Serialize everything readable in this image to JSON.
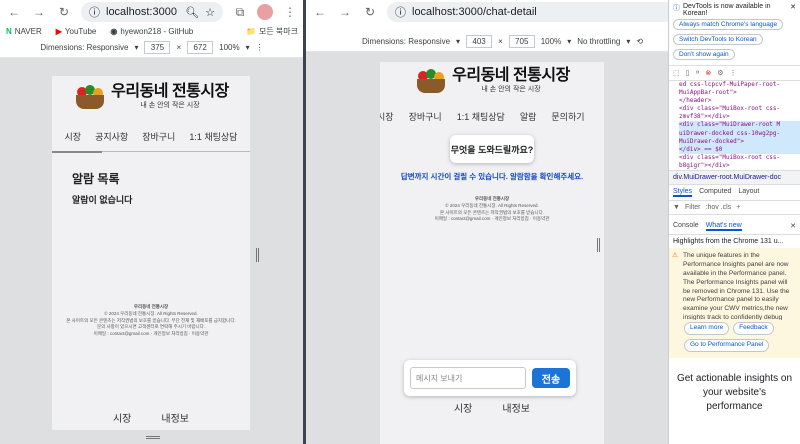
{
  "left": {
    "url": "localhost:3000",
    "bookmarks": [
      "NAVER",
      "YouTube",
      "hyewon218 - GitHub",
      "모든 북마크"
    ],
    "device": "Dimensions: Responsive",
    "width": "375",
    "height": "672",
    "zoom": "100%",
    "app": {
      "logo_title": "우리동네 전통시장",
      "logo_sub": "내 손 안의 작은 시장",
      "nav": [
        "시장",
        "공지사항",
        "장바구니",
        "1:1 채팅상담"
      ],
      "section_title": "알람 목록",
      "empty": "알람이 없습니다",
      "footer": [
        "우리동네 전통시장",
        "© 2024 우리동네 전통시장. All Rights Reserved.",
        "본 사이트의 모든 콘텐츠는 저작권법의 보호를 받습니다. 무단 전재 및 재배포를 금지합니다.",
        "문의 사항이 있으시면 고객센터로 연락해 주시기 바랍니다.",
        "이메일 : contact@gmail.com · 개인정보 처리방침 · 이용약관"
      ],
      "bottom_nav": [
        "시장",
        "내정보"
      ]
    }
  },
  "right": {
    "url": "localhost:3000/chat-detail",
    "device": "Dimensions: Responsive",
    "width": "403",
    "height": "705",
    "zoom": "100%",
    "throttle": "No throttling",
    "app": {
      "logo_title": "우리동네 전통시장",
      "logo_sub": "내 손 안의 작은 시장",
      "nav": [
        "시장",
        "장바구니",
        "1:1 채팅상담",
        "알람",
        "문의하기"
      ],
      "question": "무엇을 도와드릴까요?",
      "notice": "답변까지 시간이 걸릴 수 있습니다. 알람함을 확인해주세요.",
      "footer": [
        "우리동네 전통시장",
        "© 2024 우리동네 전통시장. All Rights Reserved.",
        "본 사이트의 모든 콘텐츠는 저작권법의 보호를 받습니다.",
        "이메일 : contact@gmail.com · 개인정보 처리방침 · 이용약관"
      ],
      "chat_placeholder": "메시지 보내기",
      "send_label": "전송",
      "bottom_nav": [
        "시장",
        "내정보"
      ]
    }
  },
  "devtools": {
    "info": "DevTools is now available in Korean!",
    "btn_match": "Always match Chrome's language",
    "btn_switch": "Switch DevTools to Korean",
    "btn_dont": "Don't show again",
    "code": [
      "ed css-lcpcvf-MuiPaper-root-",
      "MuiAppBar-root\">",
      "</header>",
      "<div class=\"MuiBox-root css-",
      "zmvf38\"></div>",
      "<div class=\"MuiDrawer-root M",
      "uiDrawer-docked css-10wg2pg-",
      "MuiDrawer-docked\">",
      "</div> == $0",
      "<div class=\"MuiBox-root css-",
      "b8gigr\"></div>"
    ],
    "breadcrumb": "div.MuiDrawer-root.MuiDrawer-doc",
    "tabs": [
      "Styles",
      "Computed",
      "Layout"
    ],
    "filter": "Filter",
    "filter_opts": ":hov .cls",
    "drawer_tabs": [
      "Console",
      "What's new"
    ],
    "highlights": "Highlights from the Chrome 131 u...",
    "warning": "The unique features in the Performance Insights panel are now available in the Performance panel. The Performance Insights panel will be removed in Chrome 131. Use the new Performance panel to easily examine your CWV metrics,the new insights track to confidently debug CLS is",
    "btn_learn": "Learn more",
    "btn_feedback": "Feedback",
    "btn_perf": "Go to Performance Panel",
    "promo": "Get actionable insights on your website's performance"
  }
}
